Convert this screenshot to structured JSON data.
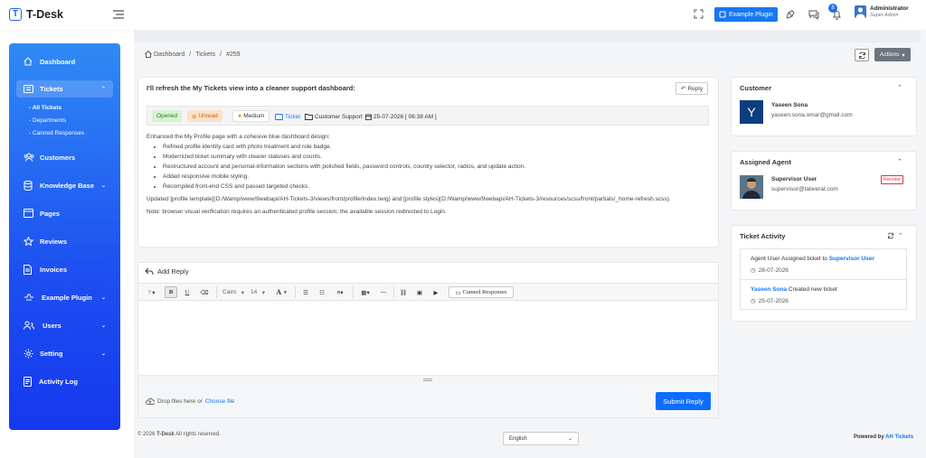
{
  "app": {
    "name": "T-Desk",
    "logo_letter": "T"
  },
  "topbar": {
    "plugin_button": "Example Plugin",
    "notification_count": "8",
    "user_name": "Administrator",
    "user_role": "Super Admin"
  },
  "sidebar": {
    "items": [
      {
        "label": "Dashboard",
        "icon": "home-icon"
      },
      {
        "label": "Tickets",
        "icon": "ticket-icon"
      },
      {
        "label": "Customers",
        "icon": "users-icon"
      },
      {
        "label": "Knowledge Base",
        "icon": "database-icon"
      },
      {
        "label": "Pages",
        "icon": "pages-icon"
      },
      {
        "label": "Reviews",
        "icon": "star-icon"
      },
      {
        "label": "Invoices",
        "icon": "invoice-icon"
      },
      {
        "label": "Example Plugin",
        "icon": "plugin-icon"
      },
      {
        "label": "Users",
        "icon": "user-icon"
      },
      {
        "label": "Setting",
        "icon": "gear-icon"
      },
      {
        "label": "Activity Log",
        "icon": "log-icon"
      }
    ],
    "sub_items": [
      "All Tickets",
      "Departments",
      "Canned Responses"
    ]
  },
  "breadcrumb": {
    "home": "Dashboard",
    "section": "Tickets",
    "current": "#259"
  },
  "actions_label": "Actions",
  "ticket": {
    "title": "I'll refresh the My Tickets view into a cleaner support dashboard:",
    "reply_label": "Reply",
    "status": "Opened",
    "read_state": "Unread",
    "priority": "Medium",
    "type": "Ticket",
    "department": "Customer Support",
    "date": "25-07-2026 [ 06:38 AM ]",
    "intro": "Enhanced the My Profile page with a cohesive blue dashboard design:",
    "bullets": [
      "Refined profile identity card with photo treatment and role badge.",
      "Modernized ticket summary with clearer statuses and counts.",
      "Restructured account and personal-information sections with polished fields, password controls, country selector, radios, and update action.",
      "Added responsive mobile styling.",
      "Recompiled front-end CSS and passed targeted checks."
    ],
    "updated": "Updated [profile template](D:/Wamp/www/9webapi/AH-Tickets-3/views/front/profile/index.twig) and [profile styles](D:/Wamp/www/9webapi/AH-Tickets-3/resources/scss/front/partials/_home-refresh.scss).",
    "note": "Note: browser visual verification requires an authenticated profile session; the available session redirected to Login."
  },
  "reply": {
    "title": "Add Reply",
    "font": "Cairo",
    "size": "14",
    "canned": "Canned Responses",
    "drop_text": "Drop files here or",
    "choose": "Choose file",
    "submit": "Submit Reply"
  },
  "customer": {
    "heading": "Customer",
    "initial": "Y",
    "name": "Yaseen Sona",
    "email": "yaseen.sona.omar@gmail.com"
  },
  "agent": {
    "heading": "Assigned Agent",
    "name": "Supervisor User",
    "email": "supervisor@tatwerat.com",
    "revoke": "Revoke"
  },
  "activity": {
    "heading": "Ticket Activity",
    "items": [
      {
        "prefix": "Agent User Assigned ticket to ",
        "link": "Supervisor User",
        "suffix": "",
        "date": "28-07-2026"
      },
      {
        "prefix": "",
        "link": "Yaseen Sona",
        "suffix": " Created new ticket",
        "date": "25-07-2026"
      }
    ]
  },
  "footer": {
    "copyright_pre": "© 2026",
    "brand": "T-Desk",
    "copyright_post": "All rights reserved.",
    "language": "English",
    "powered_pre": "Powered by",
    "powered_brand": "AH Tickets"
  },
  "colors": {
    "primary": "#0d6efd",
    "sidebar_top": "#2f8af5",
    "sidebar_bottom": "#1638ee",
    "opened_bg": "#d8f3d0",
    "unread_bg": "#fde2c8",
    "revoke": "#dc3545"
  }
}
